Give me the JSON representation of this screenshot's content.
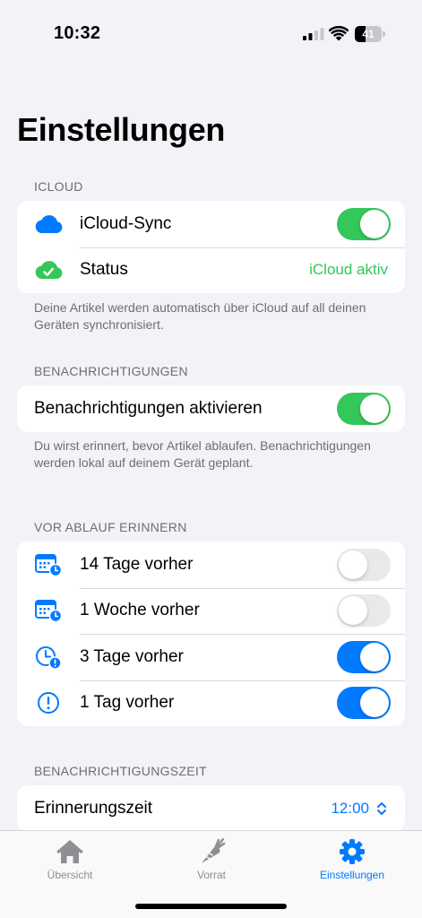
{
  "status_bar": {
    "time": "10:32",
    "battery_level": "41"
  },
  "page": {
    "title": "Einstellungen"
  },
  "icloud": {
    "header": "ICLOUD",
    "sync_label": "iCloud-Sync",
    "sync_enabled": true,
    "status_label": "Status",
    "status_value": "iCloud aktiv",
    "footer": "Deine Artikel werden automatisch über iCloud auf all deinen Geräten synchronisiert."
  },
  "notifications": {
    "header": "BENACHRICHTIGUNGEN",
    "enable_label": "Benachrichtigungen aktivieren",
    "enabled": true,
    "footer": "Du wirst erinnert, bevor Artikel ablaufen. Benachrichtigungen werden lokal auf deinem Gerät geplant."
  },
  "reminders": {
    "header": "VOR ABLAUF ERINNERN",
    "items": [
      {
        "label": "14 Tage vorher",
        "icon": "calendar-clock-icon",
        "enabled": false
      },
      {
        "label": "1 Woche vorher",
        "icon": "calendar-clock-icon",
        "enabled": false
      },
      {
        "label": "3 Tage vorher",
        "icon": "clock-badge-exclamation-icon",
        "enabled": true
      },
      {
        "label": "1 Tag vorher",
        "icon": "exclamation-circle-icon",
        "enabled": true
      }
    ]
  },
  "notification_time": {
    "header": "BENACHRICHTIGUNGSZEIT",
    "label": "Erinnerungszeit",
    "value": "12:00"
  },
  "tab_bar": {
    "tabs": [
      {
        "label": "Übersicht",
        "icon": "house-icon",
        "active": false
      },
      {
        "label": "Vorrat",
        "icon": "carrot-icon",
        "active": false
      },
      {
        "label": "Einstellungen",
        "icon": "gear-icon",
        "active": true
      }
    ]
  },
  "colors": {
    "accent": "#007aff",
    "toggle_green": "#34c759",
    "toggle_blue": "#007aff",
    "toggle_off": "#e9e9eb",
    "status_green": "#34c759",
    "background": "#f2f2f7",
    "secondary_text": "#6d6d72",
    "tab_inactive": "#8e8e93"
  }
}
